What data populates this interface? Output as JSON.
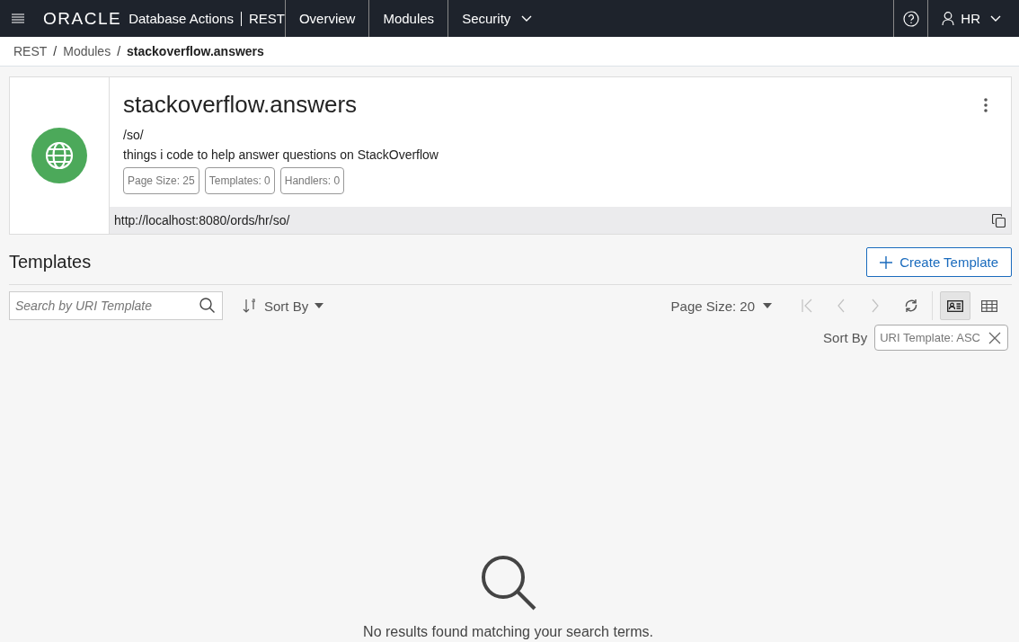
{
  "header": {
    "logo": "ORACLE",
    "app_name": "Database Actions",
    "section": "REST",
    "nav": [
      {
        "label": "Overview",
        "has_menu": false
      },
      {
        "label": "Modules",
        "has_menu": false
      },
      {
        "label": "Security",
        "has_menu": true
      }
    ],
    "user": "HR"
  },
  "breadcrumb_separator": "/",
  "breadcrumbs": [
    {
      "label": "REST",
      "current": false
    },
    {
      "label": "Modules",
      "current": false
    },
    {
      "label": "stackoverflow.answers",
      "current": true
    }
  ],
  "module": {
    "name": "stackoverflow.answers",
    "base_path": "/so/",
    "description": "things i code to help answer questions on StackOverflow",
    "badges": [
      "Page Size: 25",
      "Templates: 0",
      "Handlers: 0"
    ],
    "url": "http://localhost:8080/ords/hr/so/"
  },
  "templates": {
    "title": "Templates",
    "create_button": "Create Template",
    "search": {
      "placeholder": "Search by URI Template"
    },
    "sort_button": "Sort By",
    "page_size": "Page Size: 20",
    "pager": [
      {
        "kind": "first",
        "disabled": true
      },
      {
        "kind": "prev",
        "disabled": true
      },
      {
        "kind": "next",
        "disabled": true
      },
      {
        "kind": "refresh",
        "disabled": false
      }
    ],
    "views": [
      {
        "kind": "card",
        "selected": true
      },
      {
        "kind": "table",
        "selected": false
      }
    ],
    "sort_label": "Sort By",
    "sort_chip": "URI Template: ASC",
    "empty_message": "No results found matching your search terms."
  }
}
